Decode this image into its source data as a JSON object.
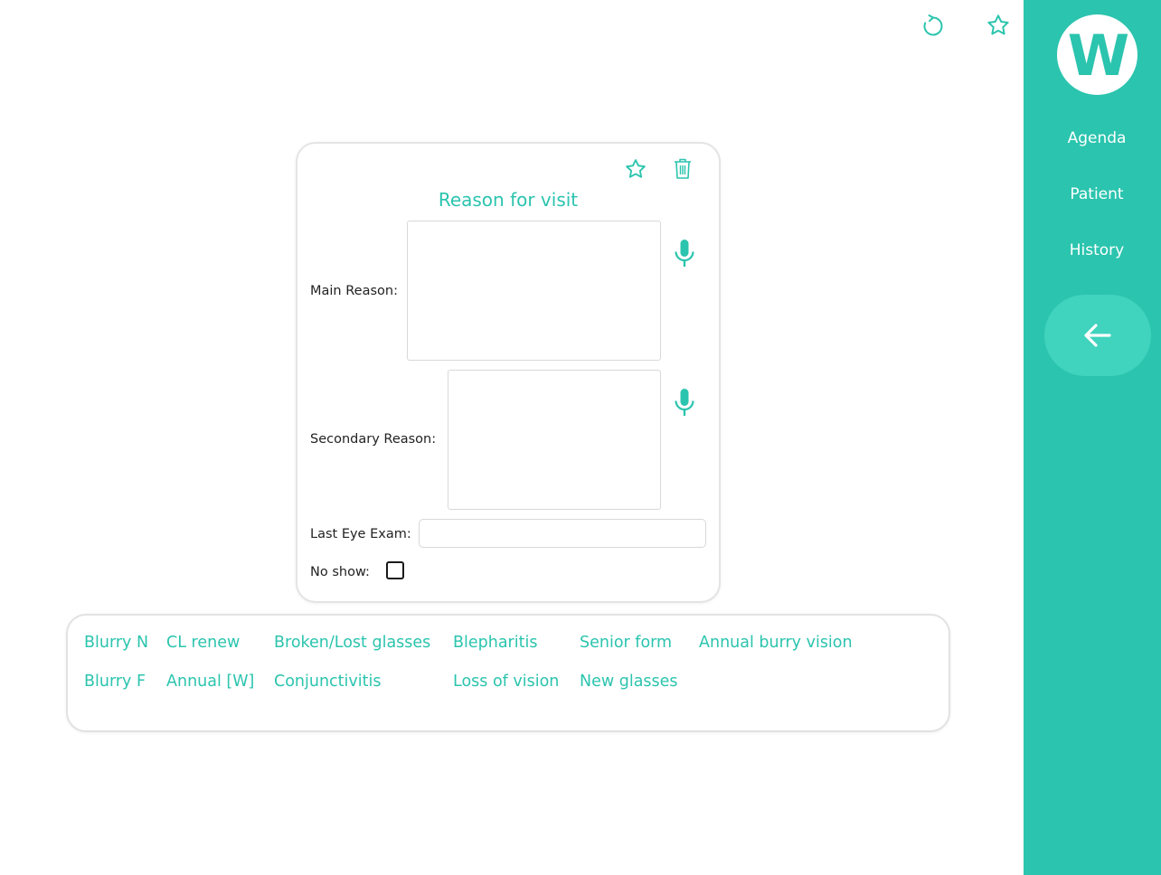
{
  "colors": {
    "accent": "#2bc4ae",
    "sidebar": "#2bc4ae",
    "back_button": "#40d3bd",
    "border": "#e4e4e4",
    "text": "#222222"
  },
  "toolbar": {
    "refresh_icon": "refresh-icon",
    "favorite_icon": "star-icon"
  },
  "sidebar": {
    "logo_letter": "W",
    "items": [
      {
        "label": "Agenda"
      },
      {
        "label": "Patient"
      },
      {
        "label": "History"
      }
    ],
    "back_icon": "arrow-left-icon"
  },
  "card": {
    "title": "Reason for visit",
    "favorite_icon": "star-icon",
    "delete_icon": "trash-icon",
    "main_reason": {
      "label": "Main Reason:",
      "value": ""
    },
    "secondary_reason": {
      "label": "Secondary Reason:",
      "value": ""
    },
    "last_eye_exam": {
      "label": "Last Eye Exam:",
      "value": ""
    },
    "no_show": {
      "label": "No show:",
      "checked": false
    }
  },
  "quick_picks": {
    "row1": [
      "Blurry N",
      "CL renew",
      "Broken/Lost glasses",
      "Blepharitis",
      "Senior form",
      "Annual burry vision"
    ],
    "row2": [
      "Blurry F",
      "Annual [W]",
      "Conjunctivitis",
      "Loss of vision",
      "New glasses"
    ]
  }
}
